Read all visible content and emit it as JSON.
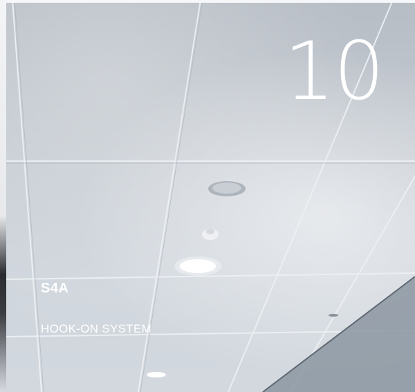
{
  "number": "10",
  "title": "S4A",
  "subtitle": "HOOK-ON SYSTEM"
}
